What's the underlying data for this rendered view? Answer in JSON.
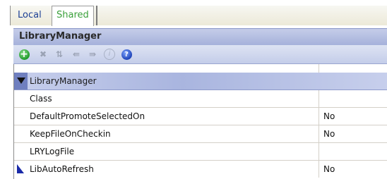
{
  "tabs": [
    {
      "label": "Local"
    },
    {
      "label": "Shared"
    }
  ],
  "panel": {
    "title": "LibraryManager"
  },
  "toolbar": {
    "buttons": [
      {
        "icon": "add-icon"
      },
      {
        "icon": "delete-icon"
      },
      {
        "icon": "sort-icon"
      },
      {
        "icon": "collapse-icon"
      },
      {
        "icon": "expand-icon"
      },
      {
        "icon": "info-icon"
      },
      {
        "icon": "help-icon"
      }
    ]
  },
  "grid": {
    "category": "LibraryManager",
    "rows": [
      {
        "name": "Class",
        "value": ""
      },
      {
        "name": "DefaultPromoteSelectedOn",
        "value": "No"
      },
      {
        "name": "KeepFileOnCheckin",
        "value": "No"
      },
      {
        "name": "LRYLogFile",
        "value": ""
      },
      {
        "name": "LibAutoRefresh",
        "value": "No"
      }
    ]
  },
  "colors": {
    "shared_tab": "#3aa03a",
    "local_tab": "#1c3f95",
    "header_band": "#a4b0da"
  }
}
